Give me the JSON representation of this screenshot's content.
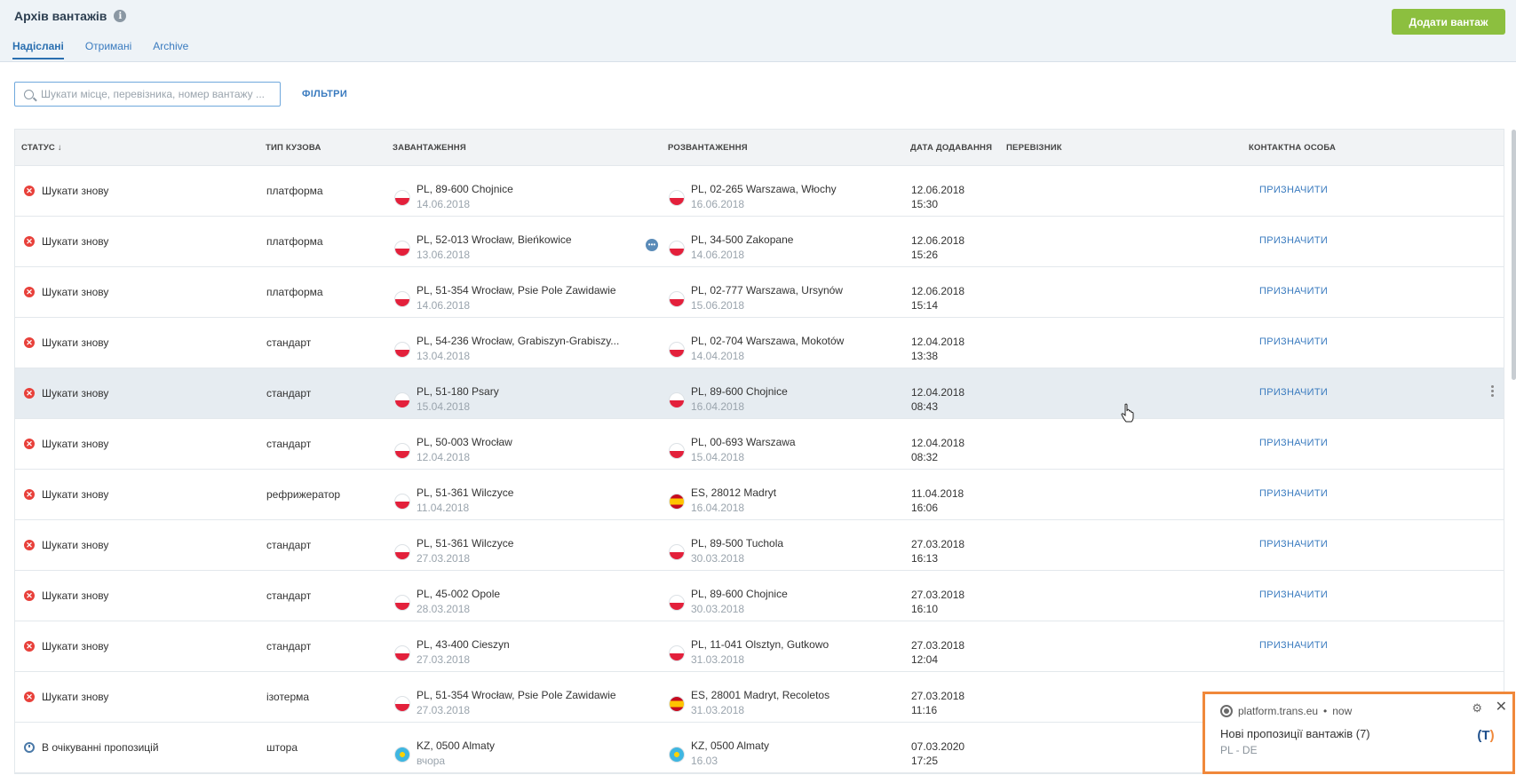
{
  "header": {
    "title": "Архів вантажів",
    "tabs": [
      {
        "label": "Надіслані",
        "active": true
      },
      {
        "label": "Отримані",
        "active": false
      },
      {
        "label": "Archive",
        "active": false
      }
    ],
    "add_button": "Додати вантаж"
  },
  "search": {
    "placeholder": "Шукати місце, перевізника, номер вантажу ..."
  },
  "filters_label": "ФІЛЬТРИ",
  "columns": {
    "status": "СТАТУС ↓",
    "body": "ТИП КУЗОВА",
    "load": "ЗАВАНТАЖЕННЯ",
    "unload": "РОЗВАНТАЖЕННЯ",
    "added": "ДАТА ДОДАВАННЯ",
    "carrier": "ПЕРЕВІЗНИК",
    "contact": "КОНТАКТНА ОСОБА"
  },
  "rows": [
    {
      "status": "Шукати знову",
      "status_icon": "error",
      "body": "платформа",
      "load_flag": "pl",
      "load_place": "PL, 89-600 Chojnice",
      "load_date": "14.06.2018",
      "unload_flag": "pl",
      "unload_place": "PL, 02-265 Warszawa, Włochy",
      "unload_date": "16.06.2018",
      "added_date": "12.06.2018",
      "added_time": "15:30",
      "assign": "ПРИЗНАЧИТИ"
    },
    {
      "status": "Шукати знову",
      "status_icon": "error",
      "body": "платформа",
      "load_flag": "pl",
      "load_place": "PL, 52-013 Wrocław, Bieńkowice",
      "load_date": "13.06.2018",
      "unload_flag": "pl",
      "unload_place": "PL, 34-500 Zakopane",
      "unload_date": "14.06.2018",
      "added_date": "12.06.2018",
      "added_time": "15:26",
      "assign": "ПРИЗНАЧИТИ",
      "chat": true
    },
    {
      "status": "Шукати знову",
      "status_icon": "error",
      "body": "платформа",
      "load_flag": "pl",
      "load_place": "PL, 51-354 Wrocław, Psie Pole Zawidawie",
      "load_date": "14.06.2018",
      "unload_flag": "pl",
      "unload_place": "PL, 02-777 Warszawa, Ursynów",
      "unload_date": "15.06.2018",
      "added_date": "12.06.2018",
      "added_time": "15:14",
      "assign": "ПРИЗНАЧИТИ"
    },
    {
      "status": "Шукати знову",
      "status_icon": "error",
      "body": "стандарт",
      "load_flag": "pl",
      "load_place": "PL, 54-236 Wrocław, Grabiszyn-Grabiszy...",
      "load_date": "13.04.2018",
      "unload_flag": "pl",
      "unload_place": "PL, 02-704 Warszawa, Mokotów",
      "unload_date": "14.04.2018",
      "added_date": "12.04.2018",
      "added_time": "13:38",
      "assign": "ПРИЗНАЧИТИ"
    },
    {
      "status": "Шукати знову",
      "status_icon": "error",
      "body": "стандарт",
      "load_flag": "pl",
      "load_place": "PL, 51-180 Psary",
      "load_date": "15.04.2018",
      "unload_flag": "pl",
      "unload_place": "PL, 89-600 Chojnice",
      "unload_date": "16.04.2018",
      "added_date": "12.04.2018",
      "added_time": "08:43",
      "assign": "ПРИЗНАЧИТИ",
      "highlight": true
    },
    {
      "status": "Шукати знову",
      "status_icon": "error",
      "body": "стандарт",
      "load_flag": "pl",
      "load_place": "PL, 50-003 Wrocław",
      "load_date": "12.04.2018",
      "unload_flag": "pl",
      "unload_place": "PL, 00-693 Warszawa",
      "unload_date": "15.04.2018",
      "added_date": "12.04.2018",
      "added_time": "08:32",
      "assign": "ПРИЗНАЧИТИ"
    },
    {
      "status": "Шукати знову",
      "status_icon": "error",
      "body": "рефрижератор",
      "load_flag": "pl",
      "load_place": "PL, 51-361 Wilczyce",
      "load_date": "11.04.2018",
      "unload_flag": "es",
      "unload_place": "ES, 28012 Madryt",
      "unload_date": "16.04.2018",
      "added_date": "11.04.2018",
      "added_time": "16:06",
      "assign": "ПРИЗНАЧИТИ"
    },
    {
      "status": "Шукати знову",
      "status_icon": "error",
      "body": "стандарт",
      "load_flag": "pl",
      "load_place": "PL, 51-361 Wilczyce",
      "load_date": "27.03.2018",
      "unload_flag": "pl",
      "unload_place": "PL, 89-500 Tuchola",
      "unload_date": "30.03.2018",
      "added_date": "27.03.2018",
      "added_time": "16:13",
      "assign": "ПРИЗНАЧИТИ"
    },
    {
      "status": "Шукати знову",
      "status_icon": "error",
      "body": "стандарт",
      "load_flag": "pl",
      "load_place": "PL, 45-002 Opole",
      "load_date": "28.03.2018",
      "unload_flag": "pl",
      "unload_place": "PL, 89-600 Chojnice",
      "unload_date": "30.03.2018",
      "added_date": "27.03.2018",
      "added_time": "16:10",
      "assign": "ПРИЗНАЧИТИ"
    },
    {
      "status": "Шукати знову",
      "status_icon": "error",
      "body": "стандарт",
      "load_flag": "pl",
      "load_place": "PL, 43-400 Cieszyn",
      "load_date": "27.03.2018",
      "unload_flag": "pl",
      "unload_place": "PL, 11-041 Olsztyn, Gutkowo",
      "unload_date": "31.03.2018",
      "added_date": "27.03.2018",
      "added_time": "12:04",
      "assign": "ПРИЗНАЧИТИ"
    },
    {
      "status": "Шукати знову",
      "status_icon": "error",
      "body": "ізотерма",
      "load_flag": "pl",
      "load_place": "PL, 51-354 Wrocław, Psie Pole Zawidawie",
      "load_date": "27.03.2018",
      "unload_flag": "es",
      "unload_place": "ES, 28001 Madryt, Recoletos",
      "unload_date": "31.03.2018",
      "added_date": "27.03.2018",
      "added_time": "11:16",
      "assign": ""
    },
    {
      "status": "В очікуванні пропозицій",
      "status_icon": "pending",
      "body": "штора",
      "load_flag": "kz",
      "load_place": "KZ, 0500 Almaty",
      "load_date": "вчора",
      "unload_flag": "kz",
      "unload_place": "KZ, 0500 Almaty",
      "unload_date": "16.03",
      "added_date": "07.03.2020",
      "added_time": "17:25",
      "assign": ""
    }
  ],
  "notification": {
    "source": "platform.trans.eu",
    "time": "now",
    "title": "Нові пропозиції вантажів (7)",
    "subtitle": "PL - DE",
    "logo_letter": "T"
  },
  "colors": {
    "accent": "#3a7bbf",
    "add_button": "#8cbf3f",
    "error": "#e8403a",
    "notification_border": "#f0883a"
  }
}
